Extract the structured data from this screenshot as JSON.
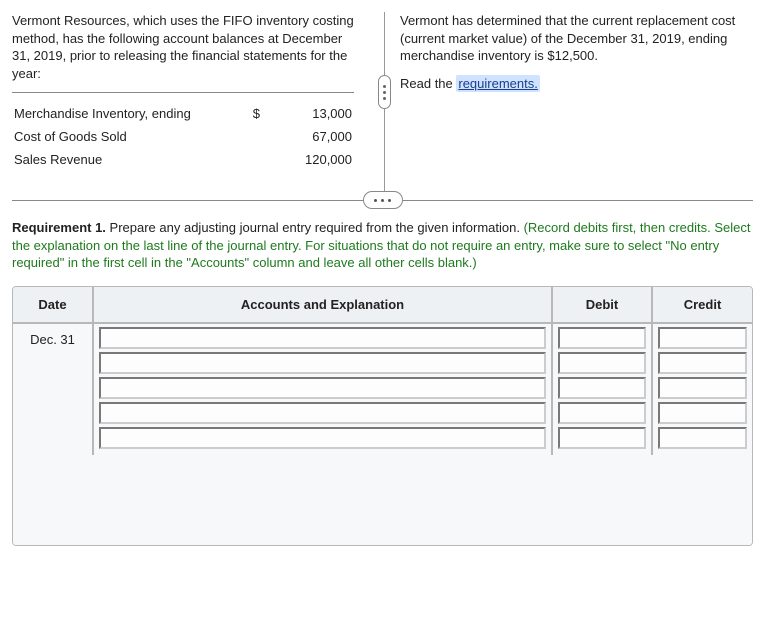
{
  "intro_left": "Vermont Resources, which uses the FIFO inventory costing method, has the following account balances at December 31, 2019, prior to releasing the financial statements for the year:",
  "intro_right_1": "Vermont has determined that the current replacement cost (current market value) of the December 31, 2019, ending merchandise inventory is $12,500.",
  "intro_right_2a": "Read the ",
  "intro_right_2b": "requirements.",
  "balances": {
    "rows": [
      {
        "label": "Merchandise Inventory, ending",
        "currency": "$",
        "amount": "13,000"
      },
      {
        "label": "Cost of Goods Sold",
        "currency": "",
        "amount": "67,000"
      },
      {
        "label": "Sales Revenue",
        "currency": "",
        "amount": "120,000"
      }
    ]
  },
  "requirement": {
    "prefix": "Requirement 1.",
    "black": " Prepare any adjusting journal entry required from the given information. ",
    "green": "(Record debits first, then credits. Select the explanation on the last line of the journal entry. For situations that do not require an entry, make sure to select \"No entry required\" in the first cell in the \"Accounts\" column and leave all other cells blank.)"
  },
  "journal": {
    "headers": {
      "date": "Date",
      "accounts": "Accounts and Explanation",
      "debit": "Debit",
      "credit": "Credit"
    },
    "date_value": "Dec. 31"
  }
}
